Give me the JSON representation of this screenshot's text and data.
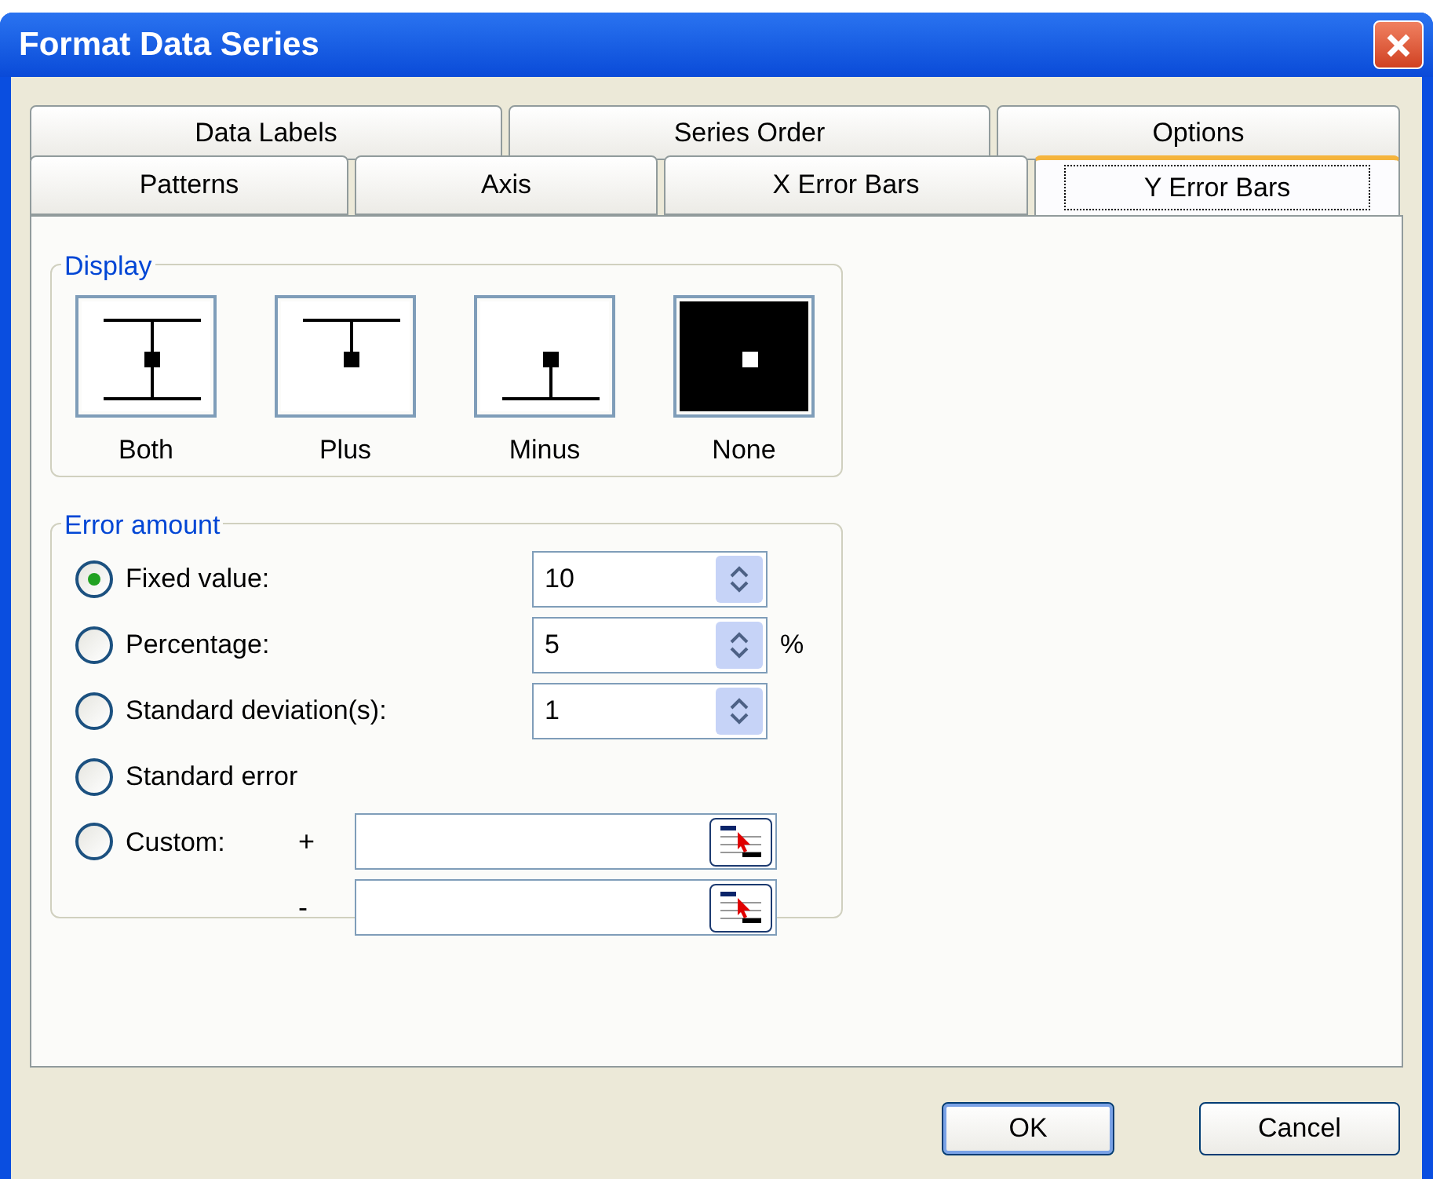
{
  "window": {
    "title": "Format Data Series"
  },
  "tab_rows": [
    [
      {
        "label": "Data Labels",
        "selected": false
      },
      {
        "label": "Series Order",
        "selected": false
      },
      {
        "label": "Options",
        "selected": false
      }
    ],
    [
      {
        "label": "Patterns",
        "selected": false
      },
      {
        "label": "Axis",
        "selected": false
      },
      {
        "label": "X Error Bars",
        "selected": false
      },
      {
        "label": "Y Error Bars",
        "selected": true
      }
    ]
  ],
  "display": {
    "title": "Display",
    "options": [
      {
        "kind": "both",
        "label": "Both",
        "selected": false
      },
      {
        "kind": "plus",
        "label": "Plus",
        "selected": false
      },
      {
        "kind": "minus",
        "label": "Minus",
        "selected": false
      },
      {
        "kind": "none",
        "label": "None",
        "selected": true
      }
    ]
  },
  "error_amount": {
    "title": "Error amount",
    "options": [
      {
        "kind": "spin",
        "label": "Fixed value:",
        "selected": true,
        "value": "10"
      },
      {
        "kind": "spin",
        "label": "Percentage:",
        "selected": false,
        "value": "5",
        "unit": "%"
      },
      {
        "kind": "spin",
        "label": "Standard deviation(s):",
        "selected": false,
        "value": "1"
      },
      {
        "kind": "plain",
        "label": "Standard error",
        "selected": false
      },
      {
        "kind": "custom",
        "label": "Custom:",
        "selected": false,
        "fields": [
          {
            "sign": "+"
          },
          {
            "sign": "-"
          }
        ]
      }
    ]
  },
  "buttons": [
    {
      "label": "OK",
      "default": true
    },
    {
      "label": "Cancel",
      "default": false
    }
  ]
}
